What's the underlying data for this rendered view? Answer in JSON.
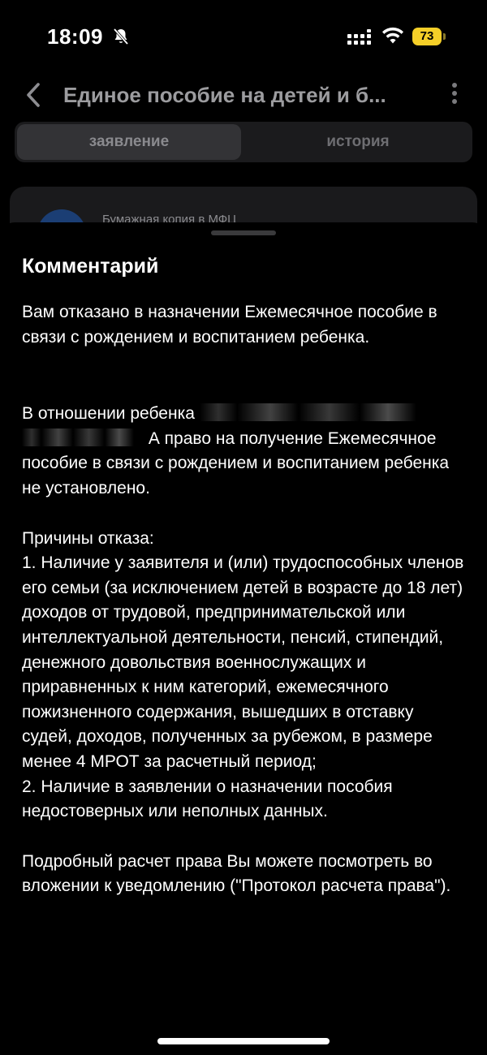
{
  "status_bar": {
    "time": "18:09",
    "battery_level": "73",
    "battery_color": "#f5cf28",
    "icons": [
      "bell-slash-icon",
      "cellular-signal-icon",
      "wifi-icon",
      "battery-icon"
    ]
  },
  "header": {
    "title": "Единое пособие на детей и б...",
    "back_icon": "chevron-left-icon",
    "more_icon": "more-vertical-icon"
  },
  "tabs": [
    {
      "label": "заявление",
      "active": true
    },
    {
      "label": "история",
      "active": false
    }
  ],
  "background_card": {
    "text": "Бумажная копия в МФЦ"
  },
  "sheet": {
    "title": "Комментарий",
    "paragraphs": {
      "p1": "Вам отказано в назначении Ежемесячное пособие в связи с рождением и воспитанием ребенка.",
      "p2_start": "В отношении ребенка",
      "p2_end": "А право на получение Ежемесячное пособие в связи с рождением и воспитанием ребенка не установлено.",
      "reasons_header": "Причины отказа:",
      "reason_1": "1. Наличие у заявителя и (или) трудоспособных членов его семьи (за исключением детей в возрасте до 18 лет) доходов от трудовой, предпринимательской или интеллектуальной деятельности, пенсий, стипендий, денежного довольствия военнослужащих и приравненных к ним категорий, ежемесячного пожизненного содержания, вышедших в отставку судей, доходов, полученных за рубежом, в размере менее 4 МРОТ за расчетный период;",
      "reason_2": "2. Наличие в заявлении о назначении пособия недостоверных или неполных данных.",
      "p_last": "Подробный расчет права Вы можете посмотреть во вложении к уведомлению (\"Протокол расчета права\")."
    }
  }
}
